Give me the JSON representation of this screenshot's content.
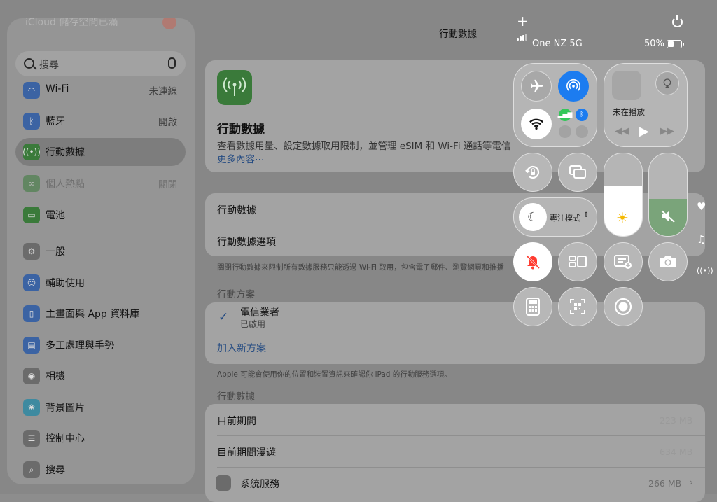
{
  "sidebar": {
    "top_text": "iCloud 儲存空間已滿",
    "search_placeholder": "搜尋",
    "items": [
      {
        "label": "Wi-Fi",
        "value": "未連線"
      },
      {
        "label": "藍牙",
        "value": "開啟"
      },
      {
        "label": "行動數據"
      },
      {
        "label": "個人熱點",
        "value": "關閉"
      },
      {
        "label": "電池"
      },
      {
        "label": "一般"
      },
      {
        "label": "輔助使用"
      },
      {
        "label": "主畫面與 App 資料庫"
      },
      {
        "label": "多工處理與手勢"
      },
      {
        "label": "相機"
      },
      {
        "label": "背景圖片"
      },
      {
        "label": "控制中心"
      },
      {
        "label": "搜尋"
      }
    ]
  },
  "main": {
    "nav_title": "行動數據",
    "header": {
      "title": "行動數據",
      "description": "查看數據用量、設定數據取用限制，並管理 eSIM 和 Wi-Fi 通話等電信",
      "more_link": "更多內容⋯"
    },
    "rows1": [
      "行動數據",
      "行動數據選項"
    ],
    "footer1": "關閉行動數據來限制所有數據服務只能透過 Wi-Fi 取用，包含電子郵件、瀏覽網頁和推播",
    "plans_header": "行動方案",
    "plan": {
      "name": "電信業者",
      "status": "已啟用"
    },
    "add_plan": "加入新方案",
    "footer2": "Apple 可能會使用你的位置和裝置資訊來確認你 iPad 的行動服務選項。",
    "usage_header": "行動數據",
    "usage_rows": [
      {
        "label": "目前期間",
        "value": "223 MB"
      },
      {
        "label": "目前期間漫遊",
        "value": "634 MB"
      },
      {
        "label": "系統服務",
        "value": "266 MB"
      }
    ]
  },
  "control_center": {
    "carrier": "One NZ 5G",
    "battery": "50%",
    "battery_level": 0.5,
    "now_playing": "未在播放",
    "focus_label": "專注模式",
    "brightness_level": 0.6,
    "volume_level": 0.45,
    "colors": {
      "accent_blue": "#1c7cf0",
      "cellular_green": "#34c759",
      "silent_red": "#ff3b30"
    }
  }
}
